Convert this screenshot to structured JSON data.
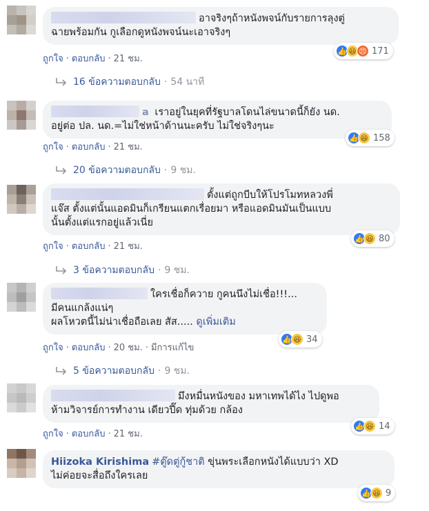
{
  "colors": {
    "link": "#385898",
    "meta": "#606770",
    "bubble": "#f2f3f5",
    "like": "#2e7bf6"
  },
  "comments": [
    {
      "name": "",
      "text_lines": [
        "อาจริงๆถ้าหนังพจน์กับรายการลุงตู่",
        "ฉายพร้อมกัน กูเลือกดูหนังพจน์นะเอาจริงๆ"
      ],
      "reaction_icons": [
        "like-icon",
        "haha-icon",
        "angry-icon"
      ],
      "reaction_count": "171",
      "like": "ถูกใจ",
      "reply": "ตอบกลับ",
      "time": "21 ชม.",
      "replies_label": "16 ข้อความตอบกลับ",
      "replies_time": "54 นาที"
    },
    {
      "name": "a",
      "text_lines": [
        "เราอยู่ในยุคที่รัฐบาลโดนไล่ขนาดนี้ก็ยัง นด.",
        "อยู่ต่อ ปล. นด.=ไม่ใช่หน้าด้านนะครับ ไม่ใช่จริงๆนะ"
      ],
      "reaction_icons": [
        "like-icon",
        "haha-icon"
      ],
      "reaction_count": "158",
      "like": "ถูกใจ",
      "reply": "ตอบกลับ",
      "time": "21 ชม.",
      "replies_label": "20 ข้อความตอบกลับ",
      "replies_time": "9 ชม."
    },
    {
      "name": "",
      "text_lines": [
        "ตั้งแต่ถูกบีบให้โปรโมทหลวงพี่",
        "แจ๊ส ตั้งแต่นั้นแอดมินก็เกรียนแตกเรื่อยมา หรือแอดมินมันเป็นแบบ",
        "นั้นตั้งแต่แรกอยู่แล้วเนี่ย"
      ],
      "reaction_icons": [
        "like-icon",
        "haha-icon"
      ],
      "reaction_count": "80",
      "like": "ถูกใจ",
      "reply": "ตอบกลับ",
      "time": "21 ชม.",
      "replies_label": "3 ข้อความตอบกลับ",
      "replies_time": "9 ชม."
    },
    {
      "name": "",
      "text_lines": [
        "ใครเชื่อก็ควาย กูคนนึงไม่เชื่อ!!!...",
        "มีคนแกล้งแน่ๆ",
        "ผลโหวตนี้ไม่น่าเชื่อถือเลย สัส....."
      ],
      "see_more": "ดูเพิ่มเติม",
      "reaction_icons": [
        "like-icon",
        "haha-icon"
      ],
      "reaction_count": "34",
      "like": "ถูกใจ",
      "reply": "ตอบกลับ",
      "time": "20 ชม.",
      "edited": "มีการแก้ไข",
      "replies_label": "5 ข้อความตอบกลับ",
      "replies_time": "9 ชม."
    },
    {
      "name": "",
      "text_lines": [
        "มึงหมื่นหนังของ มหาเทพได้ไง ไปดูพอ",
        "ห้ามวิจารย์การทำงาน เดียวปี๊ด ทุ่มด้วย กล้อง"
      ],
      "reaction_icons": [
        "like-icon",
        "haha-icon"
      ],
      "reaction_count": "14",
      "like": "ถูกใจ",
      "reply": "ตอบกลับ",
      "time": "21 ชม."
    },
    {
      "name": "Hiizoka Kirishima",
      "hashtag": "#ตู๊ดตู่กู้ชาติ",
      "text_lines": [
        "ขุ่นพระเลือกหนังได้แบบว่า XD",
        "ไม่ค่อยจะสื่อถึงใครเลย"
      ],
      "reaction_icons": [
        "like-icon",
        "haha-icon"
      ],
      "reaction_count": "9"
    }
  ]
}
